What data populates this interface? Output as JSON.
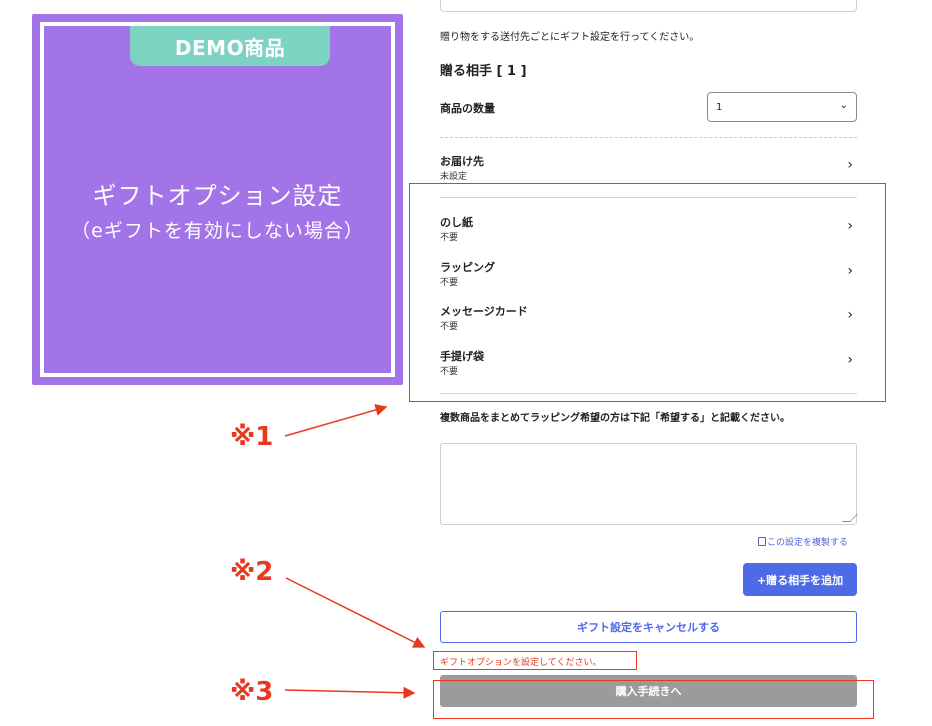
{
  "demo_card": {
    "badge": "DEMO商品",
    "title": "ギフトオプション設定",
    "subtitle": "（eギフトを有効にしない場合）"
  },
  "gift": {
    "description": "贈り物をする送付先ごとにギフト設定を行ってください。",
    "recipient_title": "贈る相手 [ 1 ]",
    "quantity_label": "商品の数量",
    "quantity_value": "1",
    "rows": [
      {
        "label": "お届け先",
        "value": "未設定"
      },
      {
        "label": "のし紙",
        "value": "不要"
      },
      {
        "label": "ラッピング",
        "value": "不要"
      },
      {
        "label": "メッセージカード",
        "value": "不要"
      },
      {
        "label": "手提げ袋",
        "value": "不要"
      }
    ],
    "bulk_note": "複数商品をまとめてラッピング希望の方は下記「希望する」と記載ください。",
    "copy_link": "この設定を複製する",
    "add_button": "+贈る相手を追加",
    "cancel_button": "ギフト設定をキャンセルする",
    "error_message": "ギフトオプションを設定してください。",
    "purchase_button": "購入手続きへ"
  },
  "annotations": {
    "note1": "※1",
    "note2": "※2",
    "note3": "※3"
  },
  "colors": {
    "card": "#a374e8",
    "badge": "#7dd3c2",
    "accent": "#4f6ae6",
    "annotation": "#e8391f",
    "disabled": "#9b9b9b"
  }
}
